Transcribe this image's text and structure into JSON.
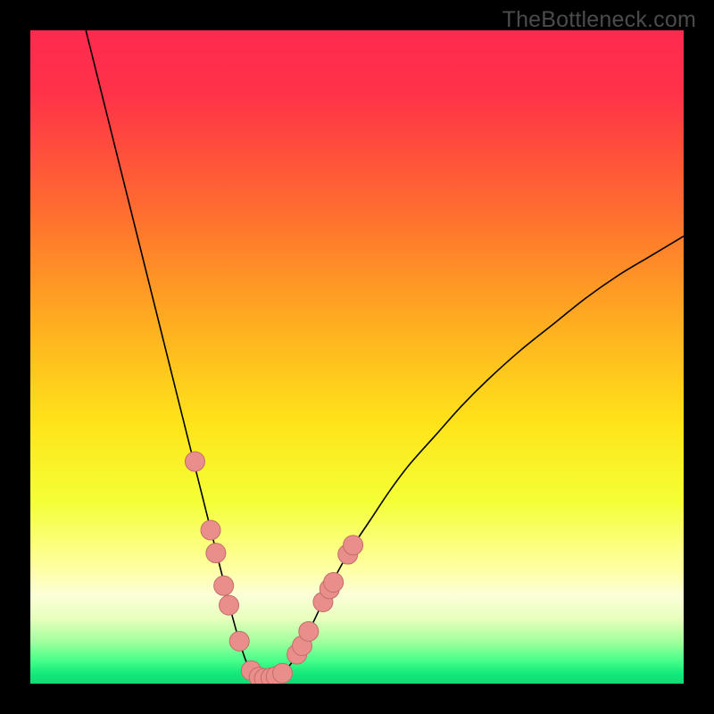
{
  "watermark": "TheBottleneck.com",
  "chart_data": {
    "type": "line",
    "title": "",
    "xlabel": "",
    "ylabel": "",
    "xlim": [
      0,
      100
    ],
    "ylim": [
      0,
      100
    ],
    "background": {
      "gradient_stops": [
        {
          "offset": 0,
          "color": "#ff2a4f"
        },
        {
          "offset": 0.1,
          "color": "#ff3348"
        },
        {
          "offset": 0.28,
          "color": "#ff6e2f"
        },
        {
          "offset": 0.45,
          "color": "#ffae20"
        },
        {
          "offset": 0.6,
          "color": "#ffe31a"
        },
        {
          "offset": 0.72,
          "color": "#f4ff35"
        },
        {
          "offset": 0.825,
          "color": "#ffffa4"
        },
        {
          "offset": 0.865,
          "color": "#fbffd8"
        },
        {
          "offset": 0.9,
          "color": "#e8ffbd"
        },
        {
          "offset": 0.935,
          "color": "#a4ff9e"
        },
        {
          "offset": 0.965,
          "color": "#46ff8a"
        },
        {
          "offset": 0.985,
          "color": "#12e87a"
        },
        {
          "offset": 1.0,
          "color": "#0fdd74"
        }
      ]
    },
    "series": [
      {
        "name": "curve",
        "color": "#000000",
        "stroke_width": 1.6,
        "points": [
          {
            "x": 8.5,
            "y": 100
          },
          {
            "x": 9.5,
            "y": 96
          },
          {
            "x": 11,
            "y": 90
          },
          {
            "x": 13,
            "y": 82
          },
          {
            "x": 15,
            "y": 74
          },
          {
            "x": 17,
            "y": 66
          },
          {
            "x": 19,
            "y": 58
          },
          {
            "x": 21,
            "y": 50
          },
          {
            "x": 22.5,
            "y": 44
          },
          {
            "x": 24,
            "y": 38
          },
          {
            "x": 25.5,
            "y": 32
          },
          {
            "x": 27,
            "y": 26
          },
          {
            "x": 28.5,
            "y": 20
          },
          {
            "x": 30,
            "y": 14
          },
          {
            "x": 31,
            "y": 10
          },
          {
            "x": 32,
            "y": 6.5
          },
          {
            "x": 33,
            "y": 3.5
          },
          {
            "x": 34,
            "y": 1.8
          },
          {
            "x": 35,
            "y": 1.0
          },
          {
            "x": 36,
            "y": 0.8
          },
          {
            "x": 37,
            "y": 0.9
          },
          {
            "x": 38,
            "y": 1.2
          },
          {
            "x": 39,
            "y": 2.0
          },
          {
            "x": 40,
            "y": 3.2
          },
          {
            "x": 41,
            "y": 4.8
          },
          {
            "x": 42,
            "y": 6.8
          },
          {
            "x": 43.5,
            "y": 9.8
          },
          {
            "x": 45,
            "y": 13
          },
          {
            "x": 47,
            "y": 17
          },
          {
            "x": 49,
            "y": 20.5
          },
          {
            "x": 52,
            "y": 25
          },
          {
            "x": 55,
            "y": 29.5
          },
          {
            "x": 58,
            "y": 33.5
          },
          {
            "x": 62,
            "y": 38
          },
          {
            "x": 66,
            "y": 42.5
          },
          {
            "x": 70,
            "y": 46.5
          },
          {
            "x": 75,
            "y": 51
          },
          {
            "x": 80,
            "y": 55
          },
          {
            "x": 85,
            "y": 59
          },
          {
            "x": 90,
            "y": 62.5
          },
          {
            "x": 95,
            "y": 65.5
          },
          {
            "x": 100,
            "y": 68.5
          }
        ]
      }
    ],
    "markers": {
      "color": "#e98e8a",
      "stroke": "#c26e6a",
      "radius": 11,
      "points": [
        {
          "x": 25.2,
          "y": 34
        },
        {
          "x": 27.6,
          "y": 23.5
        },
        {
          "x": 28.4,
          "y": 20
        },
        {
          "x": 29.6,
          "y": 15
        },
        {
          "x": 30.4,
          "y": 12
        },
        {
          "x": 32.0,
          "y": 6.5
        },
        {
          "x": 33.8,
          "y": 2.0
        },
        {
          "x": 35.0,
          "y": 1.0
        },
        {
          "x": 35.8,
          "y": 0.8
        },
        {
          "x": 36.8,
          "y": 0.9
        },
        {
          "x": 37.6,
          "y": 1.1
        },
        {
          "x": 38.6,
          "y": 1.6
        },
        {
          "x": 40.8,
          "y": 4.5
        },
        {
          "x": 41.6,
          "y": 5.8
        },
        {
          "x": 42.6,
          "y": 8.0
        },
        {
          "x": 44.8,
          "y": 12.5
        },
        {
          "x": 45.8,
          "y": 14.5
        },
        {
          "x": 46.4,
          "y": 15.5
        },
        {
          "x": 48.6,
          "y": 19.8
        },
        {
          "x": 49.4,
          "y": 21.2
        }
      ]
    }
  }
}
